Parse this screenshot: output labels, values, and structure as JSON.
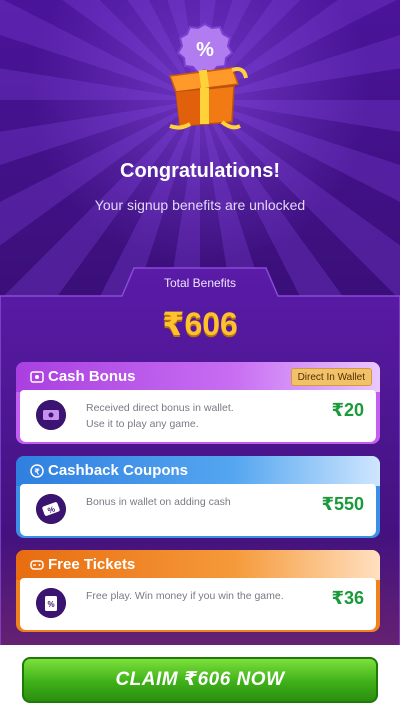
{
  "header": {
    "title": "Congratulations!",
    "subtitle": "Your signup benefits are unlocked",
    "badge_symbol": "%"
  },
  "total": {
    "label": "Total Benefits",
    "value": "₹606"
  },
  "cards": [
    {
      "title": "Cash Bonus",
      "badge": "Direct In Wallet",
      "description_line1": "Received direct bonus in wallet.",
      "description_line2": "Use it to play any game.",
      "amount": "₹20",
      "icon": "cash-icon",
      "color": "#b84ee0"
    },
    {
      "title": "Cashback Coupons",
      "description_line1": "Bonus in wallet on adding cash",
      "description_line2": "",
      "amount": "₹550",
      "icon": "coupon-icon",
      "color": "#3a8ee6"
    },
    {
      "title": "Free Tickets",
      "description_line1": "Free play. Win money if you win the game.",
      "description_line2": "",
      "amount": "₹36",
      "icon": "ticket-icon",
      "color": "#f07a1e"
    }
  ],
  "cta": {
    "label": "CLAIM ₹606 NOW"
  },
  "colors": {
    "accent_gold": "#ffc22e",
    "amount_green": "#1a9a3a",
    "cta_green": "#3fb01a"
  }
}
